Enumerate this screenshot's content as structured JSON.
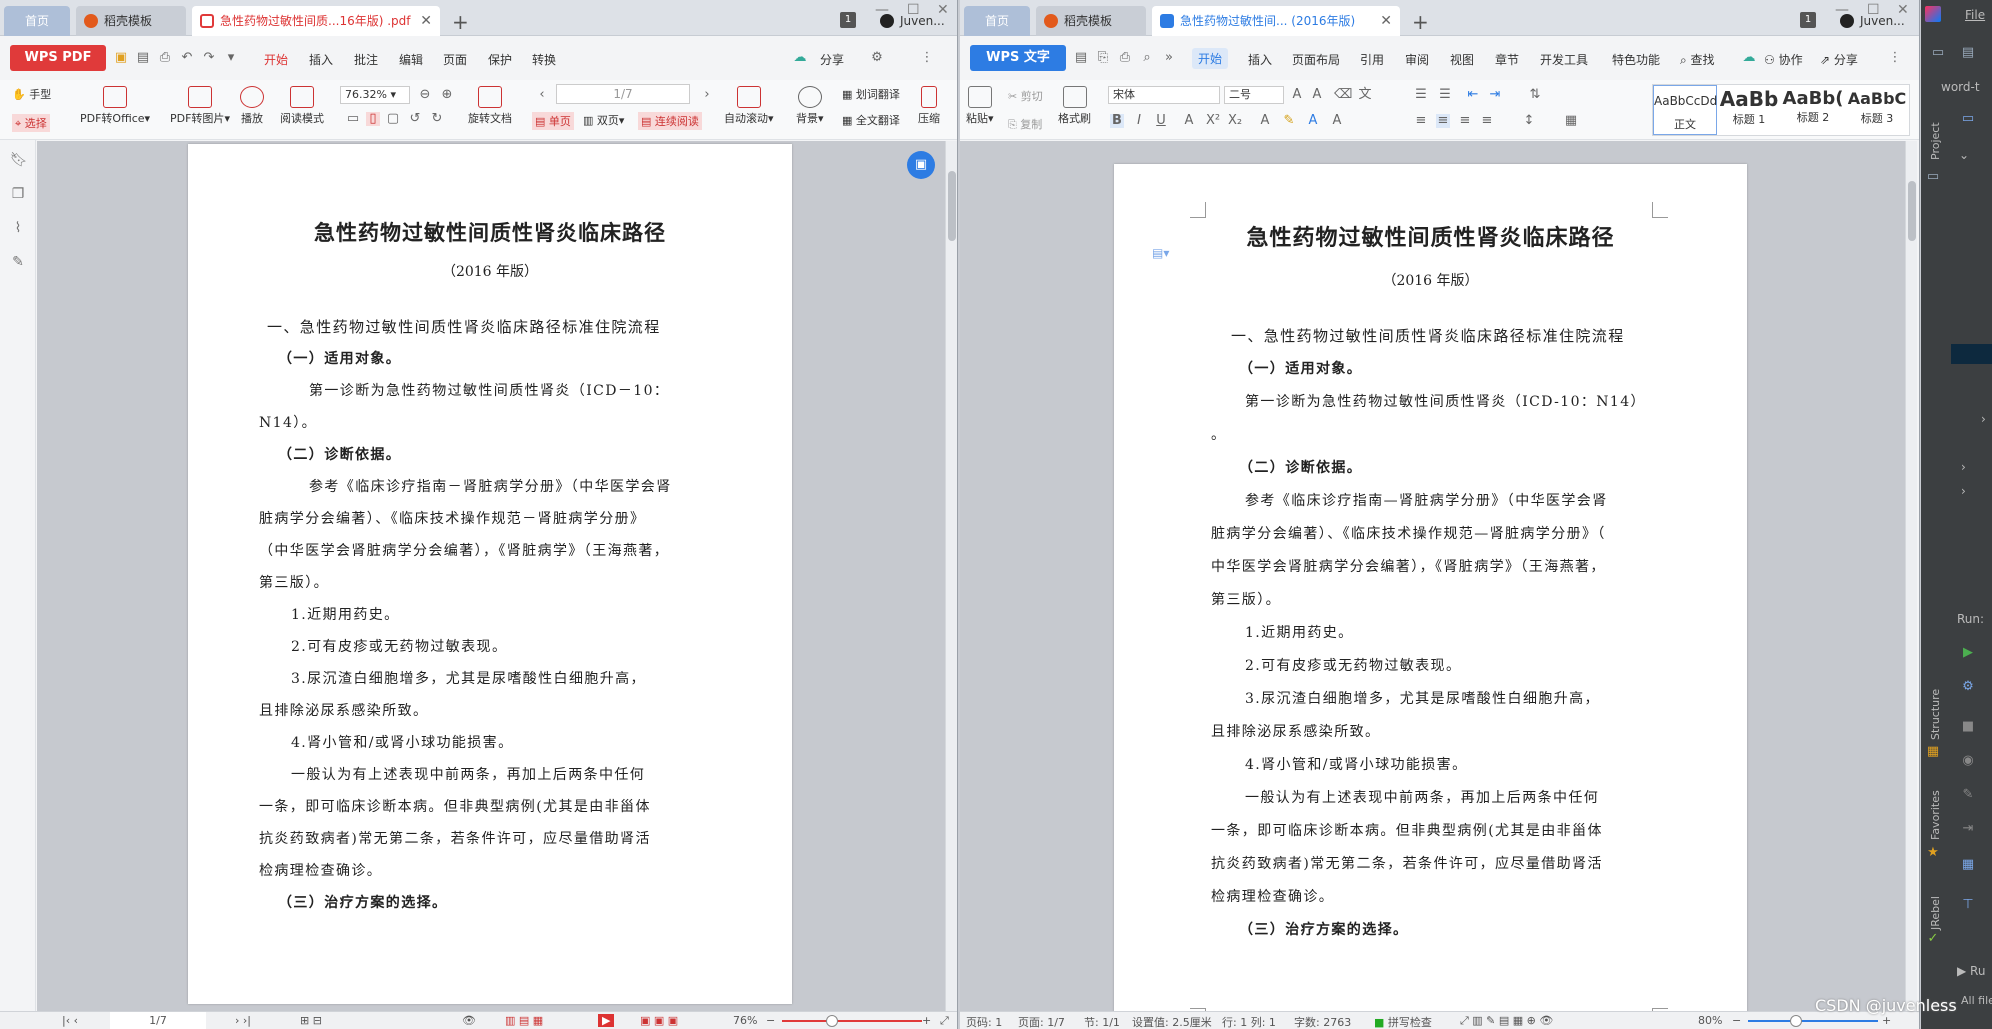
{
  "left": {
    "tabs": [
      {
        "label": "首页"
      },
      {
        "label": "稻壳模板"
      },
      {
        "label": "急性药物过敏性间质...16年版) .pdf"
      }
    ],
    "tab_count": "1",
    "user": "Juven...",
    "app_button": "WPS PDF",
    "menu": [
      "开始",
      "插入",
      "批注",
      "编辑",
      "页面",
      "保护",
      "转换"
    ],
    "share": "分享",
    "ribbon": {
      "hand": "手型",
      "select": "选择",
      "pdf_to_office": "PDF转Office",
      "pdf_to_image": "PDF转图片",
      "play": "播放",
      "read_mode": "阅读模式",
      "zoom": "76.32%",
      "rotate": "旋转文档",
      "page_input": "1/7",
      "single": "单页",
      "double": "双页",
      "continuous": "连续阅读",
      "auto_scroll": "自动滚动",
      "background": "背景",
      "word_translate": "划词翻译",
      "full_translate": "全文翻译",
      "compress": "压缩"
    },
    "status": {
      "page": "1/7",
      "zoom": "76%"
    }
  },
  "right": {
    "tabs": [
      {
        "label": "首页"
      },
      {
        "label": "稻壳模板"
      },
      {
        "label": "急性药物过敏性间... (2016年版)"
      }
    ],
    "tab_count": "1",
    "user": "Juven...",
    "app_button": "WPS 文字",
    "menu": [
      "开始",
      "插入",
      "页面布局",
      "引用",
      "审阅",
      "视图",
      "章节",
      "开发工具",
      "特色功能"
    ],
    "search": "查找",
    "collab": "协作",
    "share": "分享",
    "ribbon": {
      "paste": "粘贴",
      "cut": "剪切",
      "copy": "复制",
      "format_painter": "格式刷",
      "font": "宋体",
      "size": "二号",
      "styles": [
        {
          "preview": "AaBbCcDd",
          "name": "正文"
        },
        {
          "preview": "AaBb",
          "name": "标题 1"
        },
        {
          "preview": "AaBb(",
          "name": "标题 2"
        },
        {
          "preview": "AaBbC",
          "name": "标题 3"
        }
      ]
    },
    "status": {
      "page_num": "页码: 1",
      "pages": "页面: 1/7",
      "section": "节: 1/1",
      "setting": "设置值: 2.5厘米",
      "rowcol": "行: 1  列: 1",
      "words": "字数: 2763",
      "spell": "拼写检查",
      "zoom": "80%"
    }
  },
  "document": {
    "title": "急性药物过敏性间质性肾炎临床路径",
    "edition": "（2016 年版）",
    "edition_right": "（2016 年版）",
    "section1": "一、急性药物过敏性间质性肾炎临床路径标准住院流程",
    "h1": "（一）适用对象。",
    "p1_left_a": "第一诊断为急性药物过敏性间质性肾炎（ICD－10：",
    "p1_left_b": "N14）。",
    "p1_right_a": "第一诊断为急性药物过敏性间质性肾炎（ICD-10：N14）",
    "p1_right_b": "。",
    "h2": "（二）诊断依据。",
    "p2_left": [
      "参考《临床诊疗指南－肾脏病学分册》（中华医学会肾",
      "脏病学分会编著）、《临床技术操作规范－肾脏病学分册》",
      "（中华医学会肾脏病学分会编著），《肾脏病学》（王海燕著，",
      "第三版）。"
    ],
    "p2_right": [
      "参考《临床诊疗指南—肾脏病学分册》（中华医学会肾",
      "脏病学分会编著）、《临床技术操作规范—肾脏病学分册》（",
      "中华医学会肾脏病学分会编著），《肾脏病学》（王海燕著，",
      "第三版）。"
    ],
    "items": [
      "1.近期用药史。",
      "2.可有皮疹或无药物过敏表现。",
      "3.尿沉渣白细胞增多，尤其是尿嗜酸性白细胞升高，",
      "且排除泌尿系感染所致。",
      "4.肾小管和/或肾小球功能损害。"
    ],
    "p3": [
      "一般认为有上述表现中前两条，再加上后两条中任何",
      "一条，即可临床诊断本病。但非典型病例(尤其是由非甾体",
      "抗炎药致病者)常无第二条，若条件许可，应尽量借助肾活",
      "检病理检查确诊。"
    ],
    "h3": "（三）治疗方案的选择。"
  },
  "ide": {
    "menu": "File",
    "project_label": "word-t",
    "vtabs": [
      "Project",
      "Structure",
      "Favorites",
      "JRebel"
    ],
    "run": "Run:",
    "ru": "Ru",
    "watermark": "CSDN @juvenless",
    "all_files": "All file"
  },
  "colors": {
    "wps_pdf": "#e03a3a",
    "wps_writer": "#2d7ce3",
    "ide_bg": "#3c3f41"
  }
}
